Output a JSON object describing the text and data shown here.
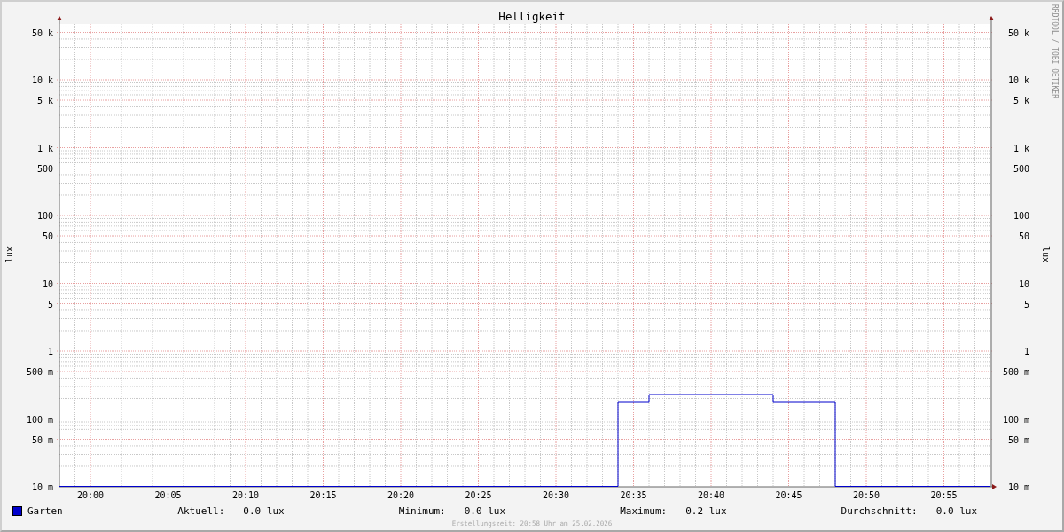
{
  "chart": {
    "title": "Helligkeit",
    "ylabel": "lux",
    "time_labels": [
      "20:00",
      "20:05",
      "20:10",
      "20:15",
      "20:20",
      "20:25",
      "20:30",
      "20:35",
      "20:40",
      "20:45",
      "20:50",
      "20:55"
    ],
    "left_axis": {
      "labels": [
        "50 k",
        "10 k",
        "5 k",
        "1 k",
        "500",
        "100",
        "50",
        "10",
        "5",
        "1",
        "500 m",
        "100 m",
        "50 m",
        "10 m"
      ]
    },
    "right_axis": {
      "title": "lux",
      "labels": [
        "50 k",
        "10 k",
        "5 k",
        "1 k",
        "500",
        "100",
        "50",
        "10",
        "5",
        "1",
        "500 m",
        "100 m",
        "50 m",
        "10 m"
      ]
    },
    "watermark": "RRDTOOL / TOBI OETIKER"
  },
  "legend": {
    "name": "Garten",
    "stats": [
      {
        "label": "Aktuell:",
        "value": "0.0 lux"
      },
      {
        "label": "Minimum:",
        "value": "0.0 lux"
      },
      {
        "label": "Maximum:",
        "value": "0.2 lux"
      },
      {
        "label": "Durchschnitt:",
        "value": "0.0 lux"
      }
    ]
  },
  "footer": "Erstellungszeit: 20:58 Uhr am 25.02.2026"
}
